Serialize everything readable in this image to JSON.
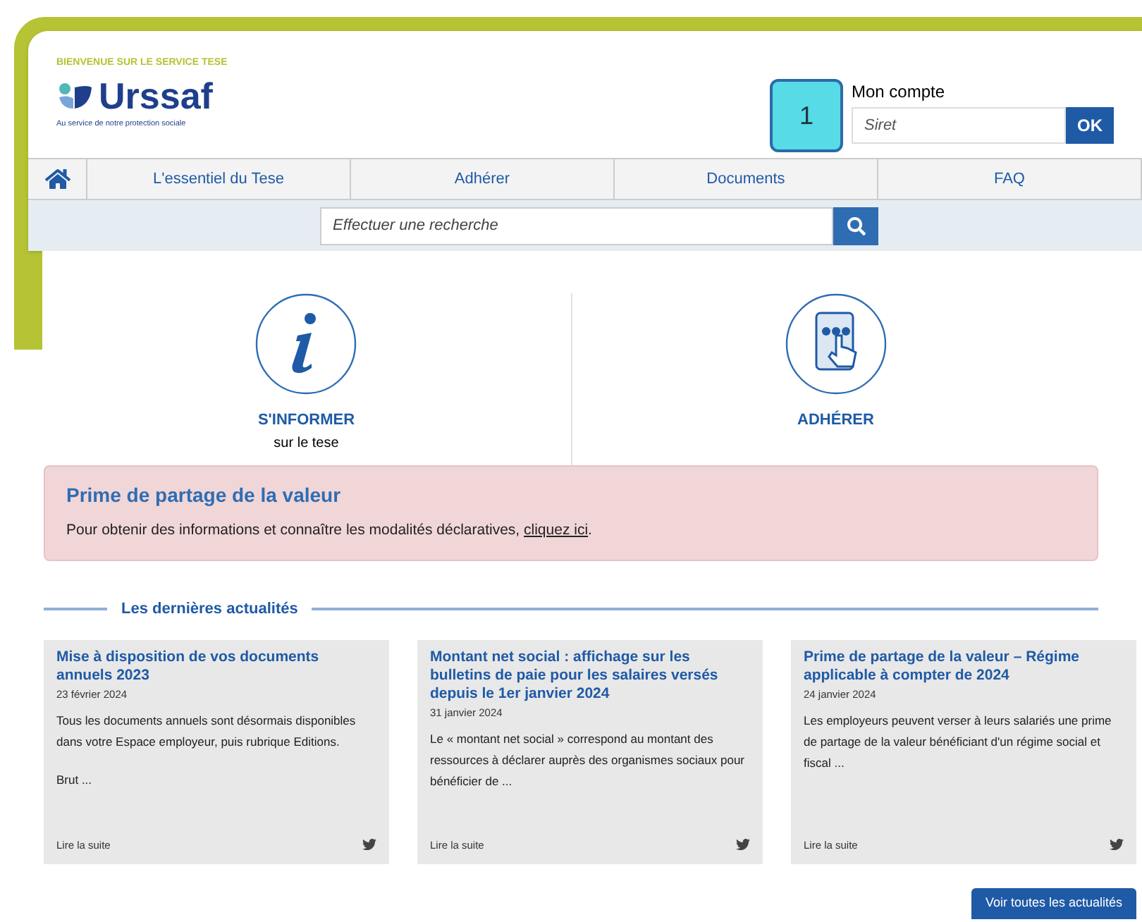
{
  "header": {
    "welcome": "BIENVENUE SUR LE SERVICE TESE",
    "logo_name": "Urssaf",
    "logo_tagline": "Au service de notre protection sociale",
    "step_badge": "1",
    "account": {
      "label": "Mon compte",
      "placeholder": "Siret",
      "button": "OK"
    }
  },
  "nav": {
    "items": [
      "L'essentiel du Tese",
      "Adhérer",
      "Documents",
      "FAQ"
    ]
  },
  "search": {
    "placeholder": "Effectuer une recherche"
  },
  "tiles": [
    {
      "kind": "info",
      "title": "S'INFORMER",
      "subtitle": "sur le tese"
    },
    {
      "kind": "join",
      "title": "ADHÉRER"
    }
  ],
  "alert": {
    "title": "Prime de partage de la valeur",
    "text": "Pour obtenir des informations et connaître les modalités déclaratives, ",
    "link": "cliquez ici",
    "text_after": "."
  },
  "news": {
    "heading": "Les dernières actualités",
    "cards": [
      {
        "title": "Mise à disposition de vos documents annuels 2023",
        "date": "23 février 2024",
        "paragraphs": [
          "Tous les documents annuels sont désormais disponibles dans votre Espace employeur, puis rubrique Editions.",
          "Brut ..."
        ],
        "more": "Lire la suite"
      },
      {
        "title": "Montant net social : affichage sur les bulletins de paie pour les salaires versés depuis le 1er janvier 2024",
        "date": "31 janvier 2024",
        "paragraphs": [
          "Le « montant net social » correspond au montant des ressources à déclarer auprès des organismes sociaux pour bénéficier de ..."
        ],
        "more": "Lire la suite"
      },
      {
        "title": "Prime de partage de la valeur – Régime applicable à compter de 2024",
        "date": "24 janvier 2024",
        "paragraphs": [
          "Les employeurs peuvent verser à leurs salariés une prime de partage de la valeur bénéficiant d'un régime social et fiscal ..."
        ],
        "more": "Lire la suite"
      }
    ],
    "all_button": "Voir toutes les actualités"
  }
}
